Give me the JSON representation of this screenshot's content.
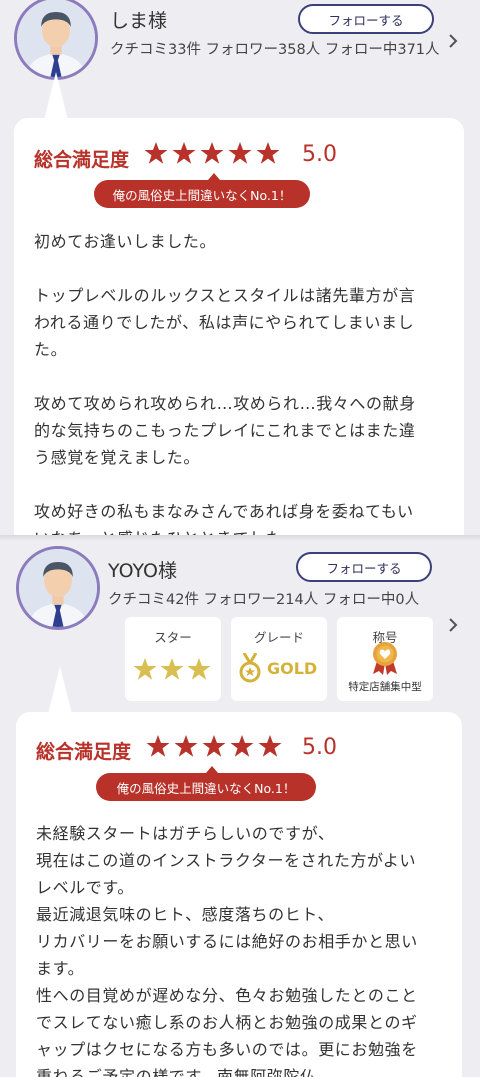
{
  "colors": {
    "accent_red": "#b8322a",
    "follow_border": "#3b3f7a",
    "gold": "#d4b23a"
  },
  "reviews": [
    {
      "user": {
        "name": "しま様",
        "stats": "クチコミ33件 フォロワー358人 フォロー中371人",
        "follow_label": "フォローする"
      },
      "satisfaction_label": "総合満足度",
      "rating": 5,
      "score": "5.0",
      "badge": "俺の風俗史上間違いなくNo.1！",
      "body_lines": [
        "初めてお逢いしました。",
        "",
        "トップレベルのルックスとスタイルは諸先輩方が言",
        "われる通りでしたが、私は声にやられてしまいまし",
        "た。",
        "",
        "攻めて攻められ攻められ…攻められ…我々への献身",
        "的な気持ちのこもったプレイにこれまでとはまた違",
        "う感覚を覚えました。",
        "",
        "攻め好きの私もまなみさんであれば身を委ねてもい",
        "いなあ…と感じたひとときでした。"
      ]
    },
    {
      "user": {
        "name": "YOYO様",
        "stats": "クチコミ42件 フォロワー214人 フォロー中0人",
        "follow_label": "フォローする"
      },
      "profile_cards": {
        "star_title": "スター",
        "star_count": 3,
        "grade_title": "グレード",
        "grade_value": "GOLD",
        "rank_title": "称号",
        "rank_value": "特定店舗集中型"
      },
      "satisfaction_label": "総合満足度",
      "rating": 5,
      "score": "5.0",
      "badge": "俺の風俗史上間違いなくNo.1！",
      "body_lines": [
        "未経験スタートはガチらしいのですが、",
        "現在はこの道のインストラクターをされた方がよい",
        "レベルです。",
        "最近減退気味のヒト、感度落ちのヒト、",
        "リカバリーをお願いするには絶好のお相手かと思い",
        "ます。",
        "性への目覚めが遅めな分、色々お勉強したとのこと",
        "でスレてない癒し系のお人柄とお勉強の成果とのギ",
        "ャップはクセになる方も多いのでは。更にお勉強を",
        "重ねるご予定の様です。南無阿弥陀仏。"
      ]
    }
  ]
}
